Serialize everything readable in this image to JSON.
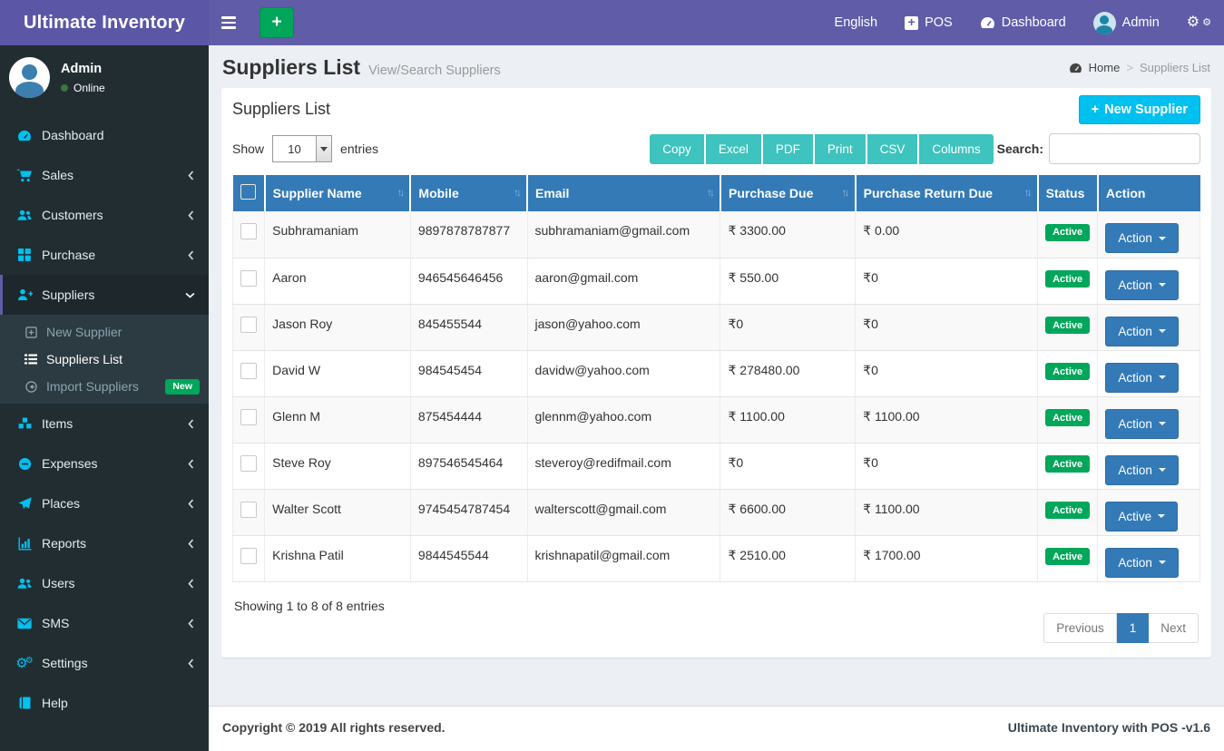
{
  "app": {
    "title": "Ultimate Inventory",
    "copyright": "Copyright © 2019 All rights reserved.",
    "version_label": "Ultimate Inventory with POS -v1.6"
  },
  "colors": {
    "header_purple": "#605ca8",
    "sidebar_dark": "#222d32",
    "icon_cyan": "#00c0ef",
    "table_header_blue": "#337ab7",
    "success_green": "#00a65a",
    "export_teal": "#3ec3be",
    "new_button_cyan": "#00c0ef"
  },
  "topnav": {
    "language": "English",
    "pos_label": "POS",
    "dashboard_label": "Dashboard",
    "user_name": "Admin"
  },
  "sidebar": {
    "user": {
      "name": "Admin",
      "status": "Online"
    },
    "items": [
      {
        "label": "Dashboard",
        "icon": "tachometer-icon"
      },
      {
        "label": "Sales",
        "icon": "cart-icon"
      },
      {
        "label": "Customers",
        "icon": "users-icon"
      },
      {
        "label": "Purchase",
        "icon": "grid-icon"
      },
      {
        "label": "Suppliers",
        "icon": "user-plus-icon"
      },
      {
        "label": "Items",
        "icon": "cubes-icon"
      },
      {
        "label": "Expenses",
        "icon": "minus-circle-icon"
      },
      {
        "label": "Places",
        "icon": "paper-plane-icon"
      },
      {
        "label": "Reports",
        "icon": "bar-chart-icon"
      },
      {
        "label": "Users",
        "icon": "users-icon"
      },
      {
        "label": "SMS",
        "icon": "envelope-icon"
      },
      {
        "label": "Settings",
        "icon": "cogs-icon"
      },
      {
        "label": "Help",
        "icon": "book-icon"
      }
    ],
    "submenu": [
      {
        "label": "New Supplier",
        "icon": "plus-square-icon"
      },
      {
        "label": "Suppliers List",
        "icon": "list-icon"
      },
      {
        "label": "Import Suppliers",
        "icon": "arrow-circle-left-icon",
        "badge": "New"
      }
    ]
  },
  "page": {
    "title": "Suppliers List",
    "subtitle": "View/Search Suppliers",
    "breadcrumb_home": "Home",
    "breadcrumb_sep": ">",
    "breadcrumb_current": "Suppliers List"
  },
  "panel": {
    "title": "Suppliers List",
    "new_button_label": "New Supplier"
  },
  "toolbar": {
    "show_label": "Show",
    "page_size": "10",
    "entries_label": "entries",
    "export_buttons": [
      "Copy",
      "Excel",
      "PDF",
      "Print",
      "CSV",
      "Columns"
    ],
    "search_label": "Search:",
    "search_value": ""
  },
  "table": {
    "columns": [
      "Supplier Name",
      "Mobile",
      "Email",
      "Purchase Due",
      "Purchase Return Due",
      "Status",
      "Action"
    ],
    "rows": [
      {
        "name": "Subhramaniam",
        "mobile": "9897878787877",
        "email": "subhramaniam@gmail.com",
        "purchase_due": "₹ 3300.00",
        "purchase_return_due": "₹ 0.00",
        "status": "Active",
        "action": "Action"
      },
      {
        "name": "Aaron",
        "mobile": "946545646456",
        "email": "aaron@gmail.com",
        "purchase_due": "₹ 550.00",
        "purchase_return_due": "₹0",
        "status": "Active",
        "action": "Action"
      },
      {
        "name": "Jason Roy",
        "mobile": "845455544",
        "email": "jason@yahoo.com",
        "purchase_due": "₹0",
        "purchase_return_due": "₹0",
        "status": "Active",
        "action": "Action"
      },
      {
        "name": "David W",
        "mobile": "984545454",
        "email": "davidw@yahoo.com",
        "purchase_due": "₹ 278480.00",
        "purchase_return_due": "₹0",
        "status": "Active",
        "action": "Action"
      },
      {
        "name": "Glenn M",
        "mobile": "875454444",
        "email": "glennm@yahoo.com",
        "purchase_due": "₹ 1100.00",
        "purchase_return_due": "₹ 1100.00",
        "status": "Active",
        "action": "Action"
      },
      {
        "name": "Steve Roy",
        "mobile": "897546545464",
        "email": "steveroy@redifmail.com",
        "purchase_due": "₹0",
        "purchase_return_due": "₹0",
        "status": "Active",
        "action": "Action"
      },
      {
        "name": "Walter Scott",
        "mobile": "9745454787454",
        "email": "walterscott@gmail.com",
        "purchase_due": "₹ 6600.00",
        "purchase_return_due": "₹ 1100.00",
        "status": "Active",
        "action": "Active"
      },
      {
        "name": "Krishna Patil",
        "mobile": "9844545544",
        "email": "krishnapatil@gmail.com",
        "purchase_due": "₹ 2510.00",
        "purchase_return_due": "₹ 1700.00",
        "status": "Active",
        "action": "Action"
      }
    ]
  },
  "table_footer": {
    "info": "Showing 1 to 8 of 8 entries",
    "previous": "Previous",
    "page": "1",
    "next": "Next"
  }
}
